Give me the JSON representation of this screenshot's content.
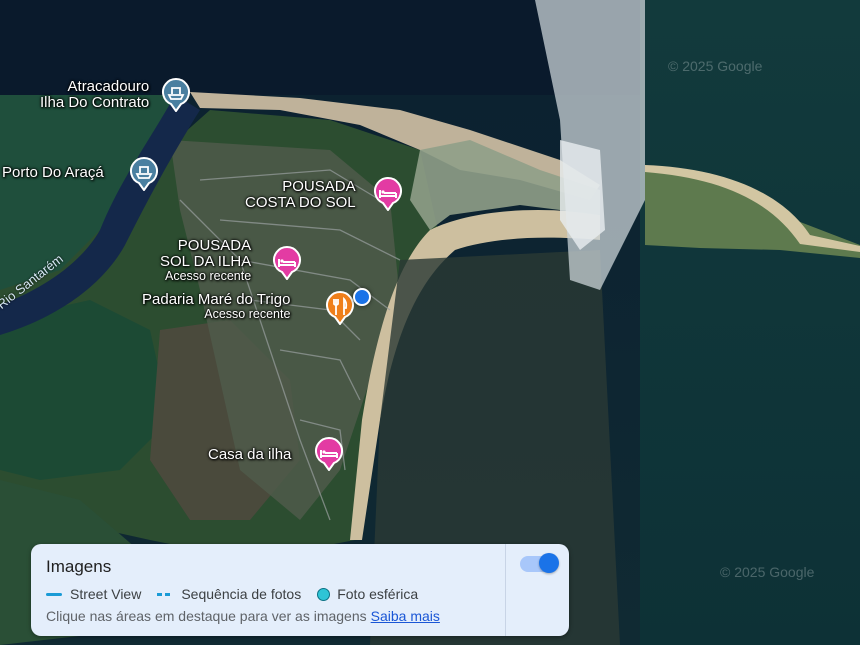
{
  "map": {
    "water_label": "Rio Santarém",
    "copyright_top": "© 2025 Google",
    "copyright_bottom": "© 2025 Google",
    "accent_color": "#1a73e8",
    "places": [
      {
        "name_line1": "Atracadouro",
        "name_line2": "Ilha Do Contrato",
        "icon": "ferry-icon",
        "color": "#4a7fa0"
      },
      {
        "name_line1": "Porto Do Araçá",
        "icon": "ferry-icon",
        "color": "#4a7fa0"
      },
      {
        "name_line1": "POUSADA",
        "name_line2": "COSTA DO SOL",
        "icon": "hotel-bed-icon",
        "color": "#e33ba3"
      },
      {
        "name_line1": "POUSADA",
        "name_line2": "SOL DA ILHA",
        "sub": "Acesso recente",
        "icon": "hotel-bed-icon",
        "color": "#e33ba3"
      },
      {
        "name_line1": "Padaria Maré do Trigo",
        "sub": "Acesso recente",
        "icon": "restaurant-fork-knife-icon",
        "color": "#ef7f1a"
      },
      {
        "name_line1": "Casa da ilha",
        "icon": "hotel-bed-icon",
        "color": "#e33ba3"
      }
    ]
  },
  "imagery_panel": {
    "title": "Imagens",
    "legend": {
      "street_view": "Street View",
      "photo_sequence": "Sequência de fotos",
      "spherical_photo": "Foto esférica"
    },
    "hint": "Clique nas áreas em destaque para ver as imagens",
    "learn_more": "Saiba mais",
    "toggle_on": true
  }
}
